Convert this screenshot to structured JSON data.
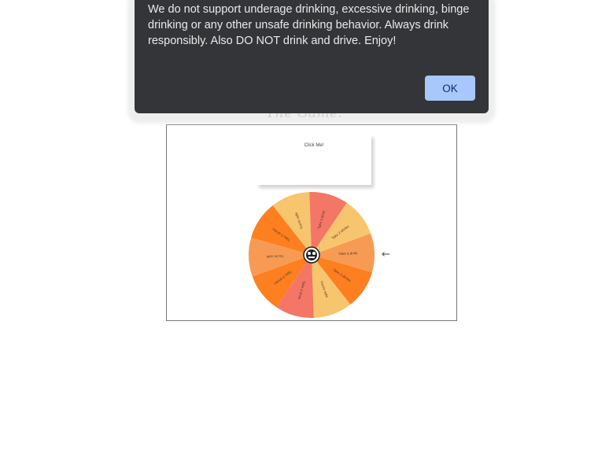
{
  "dialog": {
    "message": "We do not support underage drinking, excessive drinking, binge drinking or any other unsafe drinking behavior. Always drink responsibly. Also DO NOT drink and drive. Enjoy!",
    "ok_label": "OK"
  },
  "game": {
    "heading": "The Game:",
    "click_label": "Click Me!",
    "pointer_glyph": "←",
    "segments": [
      {
        "label": "Take a drink",
        "color": "#f79b54"
      },
      {
        "label": "Take 2 drinks",
        "color": "#fd7f1f"
      },
      {
        "label": "You're safe",
        "color": "#f7c56e"
      },
      {
        "label": "Take a drink",
        "color": "#f47666"
      },
      {
        "label": "Take 2 drinks",
        "color": "#fd7f1f"
      },
      {
        "label": "You're safe",
        "color": "#f79b54"
      },
      {
        "label": "Take 2 drinks",
        "color": "#fd7f1f"
      },
      {
        "label": "You're safe",
        "color": "#f7c56e"
      },
      {
        "label": "Take a drink",
        "color": "#f47666"
      },
      {
        "label": "Take 2 drinks",
        "color": "#f7c56e"
      }
    ]
  }
}
